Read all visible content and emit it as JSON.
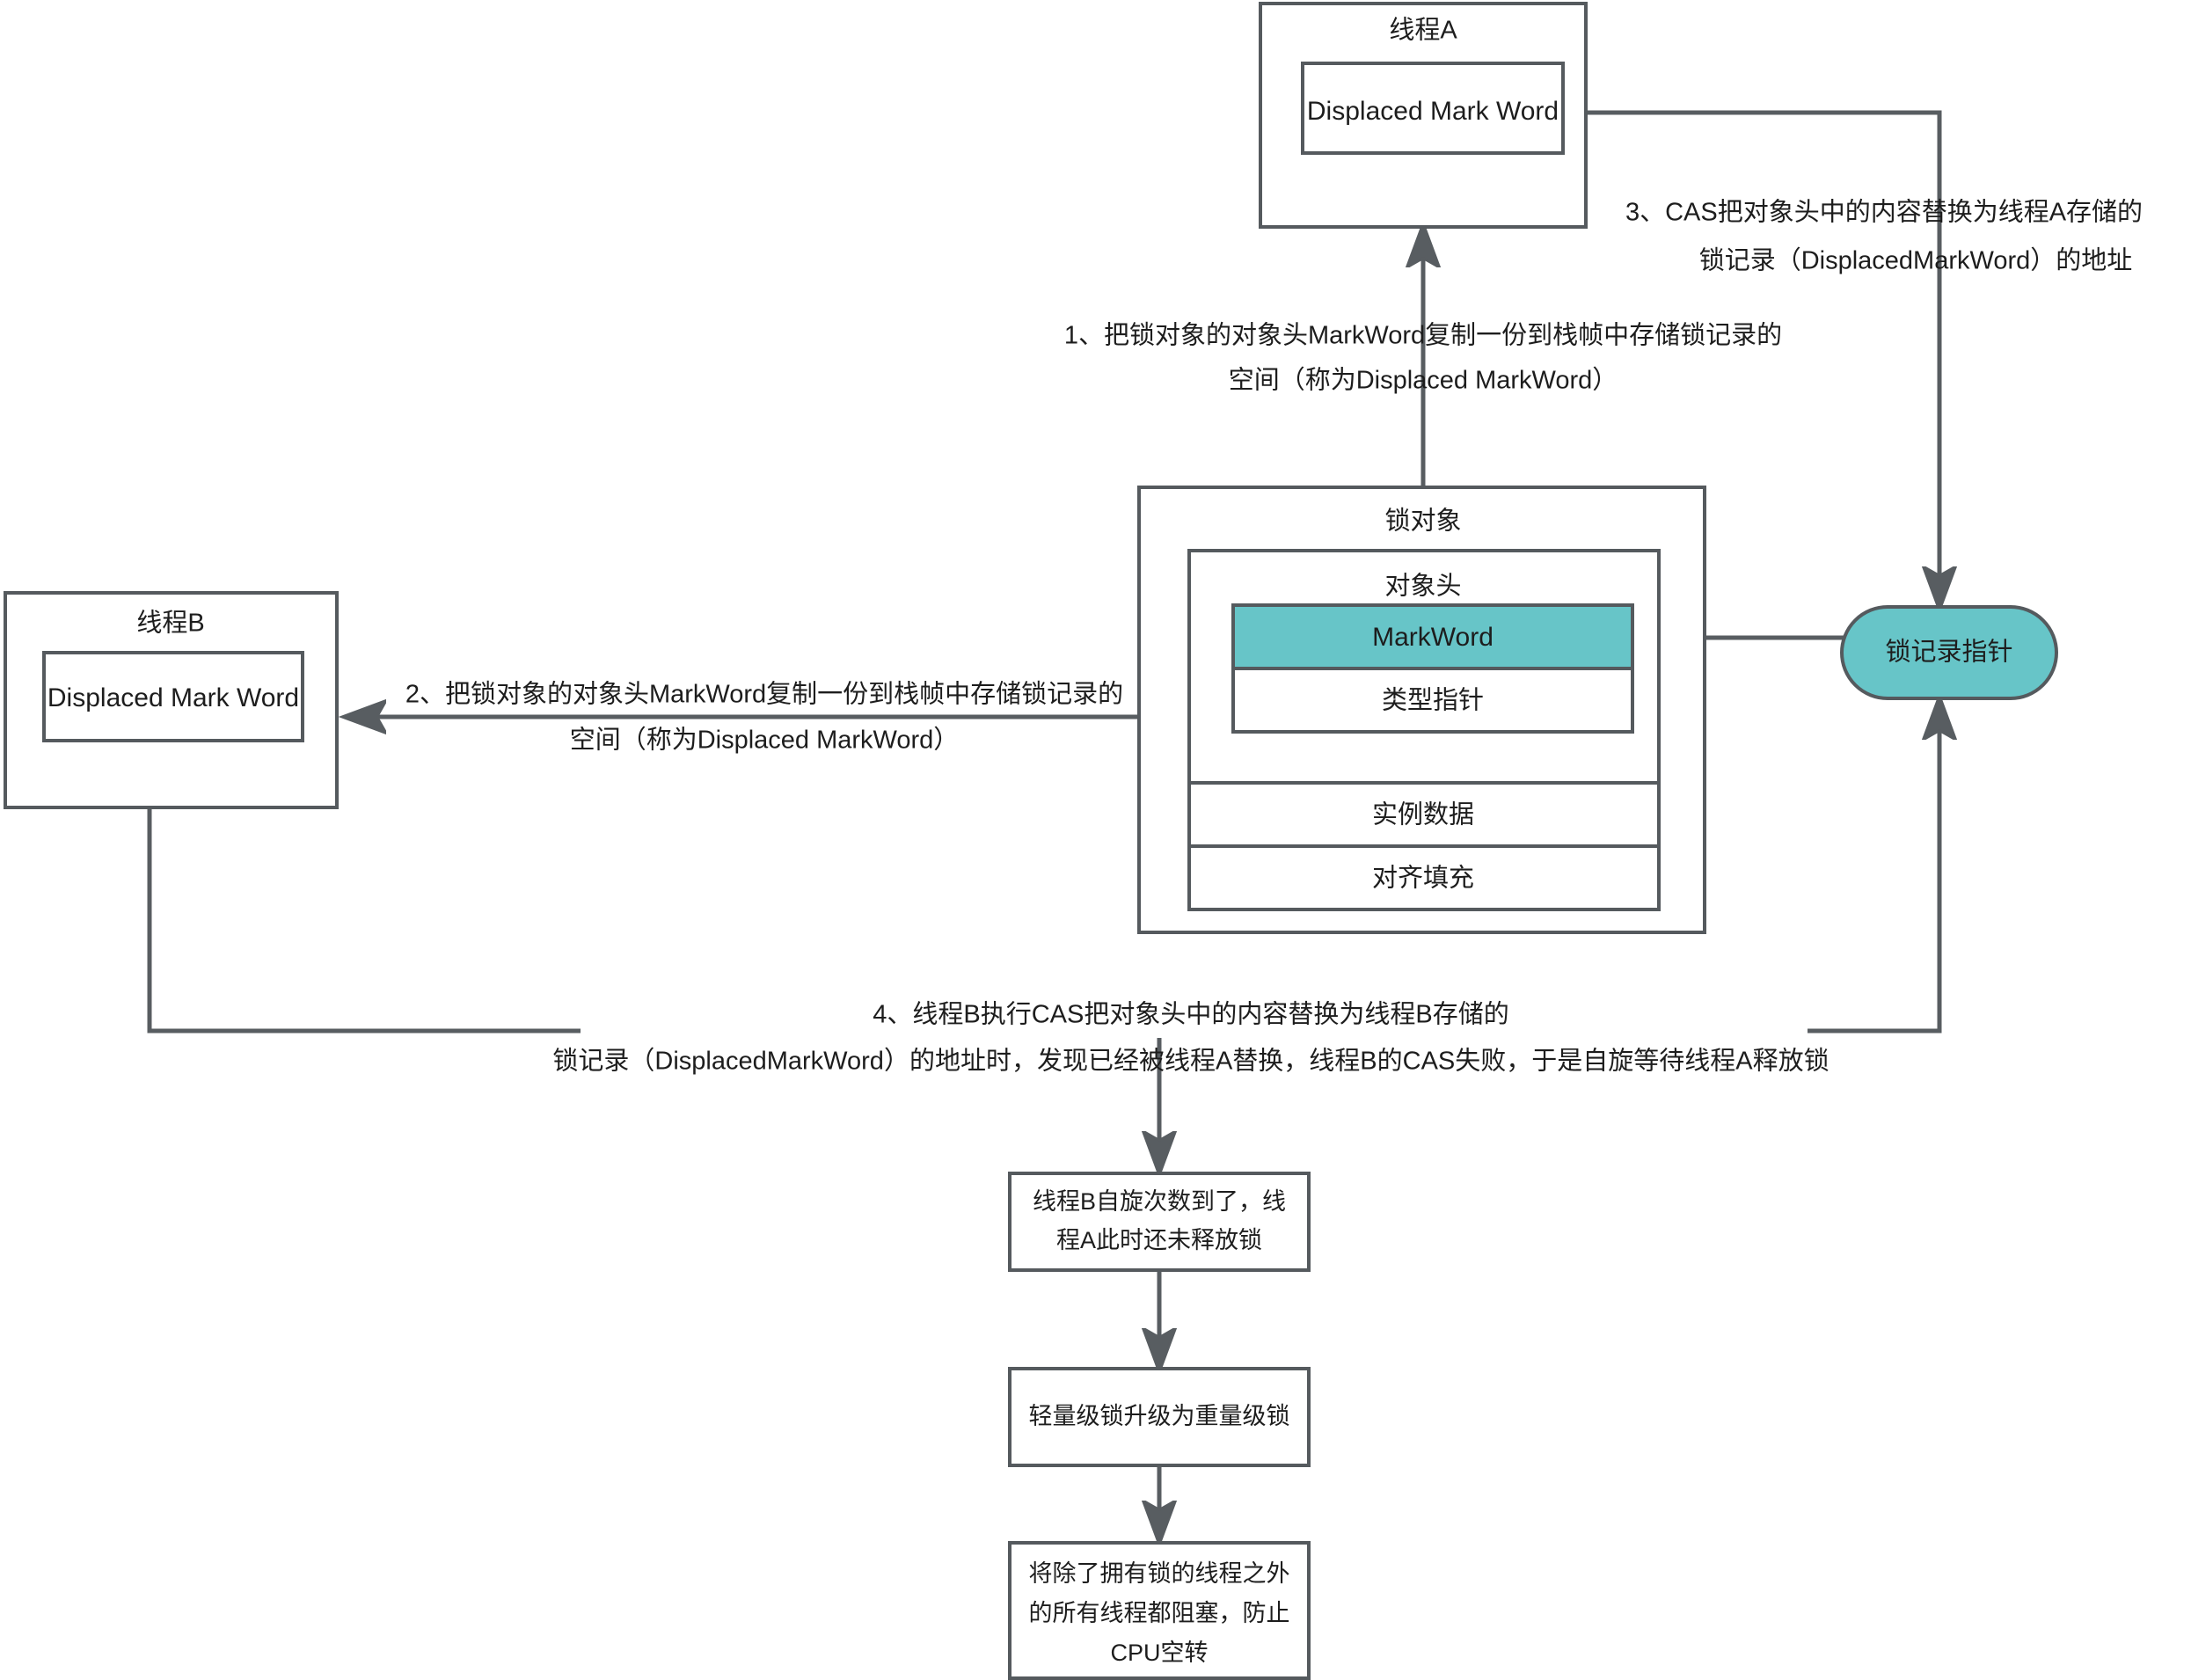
{
  "diagram": {
    "title": "Java synchronized lightweight lock upgrade flow",
    "colors": {
      "stroke": "#555a5e",
      "connector": "#585d61",
      "teal_fill": "#67c5c8",
      "box_fill": "#ffffff",
      "text": "#1d1d1d"
    },
    "nodes": {
      "thread_a": {
        "title": "线程A",
        "inner_label": "Displaced Mark Word"
      },
      "thread_b": {
        "title": "线程B",
        "inner_label": "Displaced Mark Word"
      },
      "lock_object": {
        "title": "锁对象",
        "object_header": "对象头",
        "mark_word": "MarkWord",
        "klass_pointer": "类型指针",
        "instance_data": "实例数据",
        "padding": "对齐填充"
      },
      "lock_record_pointer": {
        "label": "锁记录指针"
      },
      "spin_exhausted": {
        "line1": "线程B自旋次数到了，线",
        "line2": "程A此时还未释放锁"
      },
      "upgrade": {
        "line1": "轻量级锁升级为重量级锁"
      },
      "block_threads": {
        "line1": "将除了拥有锁的线程之外",
        "line2": "的所有线程都阻塞，防止",
        "line3": "CPU空转"
      }
    },
    "annotations": {
      "step1": {
        "line1": "1、把锁对象的对象头MarkWord复制一份到栈帧中存储锁记录的",
        "line2": "空间（称为Displaced MarkWord）"
      },
      "step2": {
        "line1": "2、把锁对象的对象头MarkWord复制一份到栈帧中存储锁记录的",
        "line2": "空间（称为Displaced MarkWord）"
      },
      "step3": {
        "line1": "3、CAS把对象头中的内容替换为线程A存储的",
        "line2": "锁记录（DisplacedMarkWord）的地址"
      },
      "step4": {
        "line1": "4、线程B执行CAS把对象头中的内容替换为线程B存储的",
        "line2": "锁记录（DisplacedMarkWord）的地址时，发现已经被线程A替换，线程B的CAS失败，于是自旋等待线程A释放锁"
      }
    }
  }
}
